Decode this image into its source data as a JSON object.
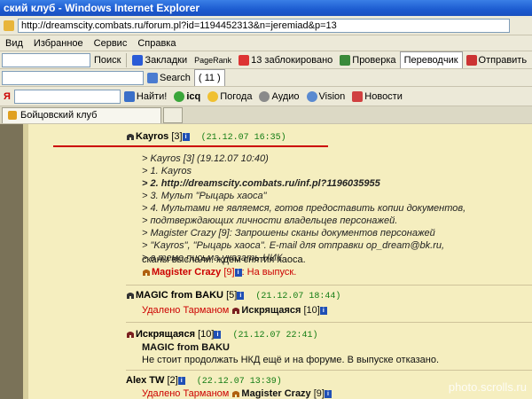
{
  "window": {
    "title": "ский клуб - Windows Internet Explorer"
  },
  "address": {
    "url": "http://dreamscity.combats.ru/forum.pl?id=1194452313&n=jeremiad&p=13"
  },
  "menu": [
    "Вид",
    "Избранное",
    "Сервис",
    "Справка"
  ],
  "toolbar1": {
    "search": "Поиск",
    "bookmarks": "Закладки",
    "pagerank": "PageRank",
    "blocked": "13 заблокировано",
    "check": "Проверка",
    "translate": "Переводчик",
    "send": "Отправить"
  },
  "toolbar2": {
    "search": "Search",
    "count": "( 11 )"
  },
  "toolbar3": {
    "find": "Найти!",
    "icq": "icq",
    "weather": "Погода",
    "audio": "Аудио",
    "vision": "Vision",
    "news": "Новости"
  },
  "tab": {
    "title": "Бойцовский клуб"
  },
  "posts": [
    {
      "author": "Kayros",
      "level": "[3]",
      "date": "(21.12.07 16:35)",
      "quote": [
        "> Kayros [3]    (19.12.07 10:40)",
        "> 1. Kayros",
        "> 2. http://dreamscity.combats.ru/inf.pl?1196035955",
        "> 3. Мульт \"Рыцарь хаоса\"",
        "> 4. Мультами не являемся, готов предоставить копии документов,",
        "> подтверждающих личности владельцев персонажей.",
        "> Magister Crazy [9]: Запрошены сканы документов персонажей",
        "> \"Kayros\", \"Рыцарь хаоса\". E-mail для отправки op_dream@bk.ru,",
        "> в теме письма указать НИК"
      ],
      "message": "сканы выслали. ждём снятия хаоса.",
      "reply_author": "Magister Crazy",
      "reply_level": "[9]",
      "reply_text": ": На выпуск."
    },
    {
      "author": "MAGIC from BAKU",
      "level": "[5]",
      "date": "(21.12.07 18:44)",
      "deleted_by": "Удалено Тарманом",
      "deleted_author": "Искрящаяся",
      "deleted_level": "[10]"
    },
    {
      "author": "Искрящаяся",
      "level": "[10]",
      "date": "(21.12.07 22:41)",
      "reply_to": "MAGIC from BAKU",
      "message": "Не стоит продолжать НКД ещё и на форуме. В выпуске отказано."
    },
    {
      "author": "Alex TW",
      "level": "[2]",
      "date": "(22.12.07 13:39)",
      "deleted_by": "Удалено Тарманом",
      "deleted_author": "Magister Crazy",
      "deleted_level": "[9]"
    }
  ],
  "watermark": "photo.scrolls.ru",
  "colors": {
    "page_bg": "#f5eebf",
    "date": "#137c13",
    "deleted": "#cc0000",
    "titlebar": "#1c5bd0"
  }
}
